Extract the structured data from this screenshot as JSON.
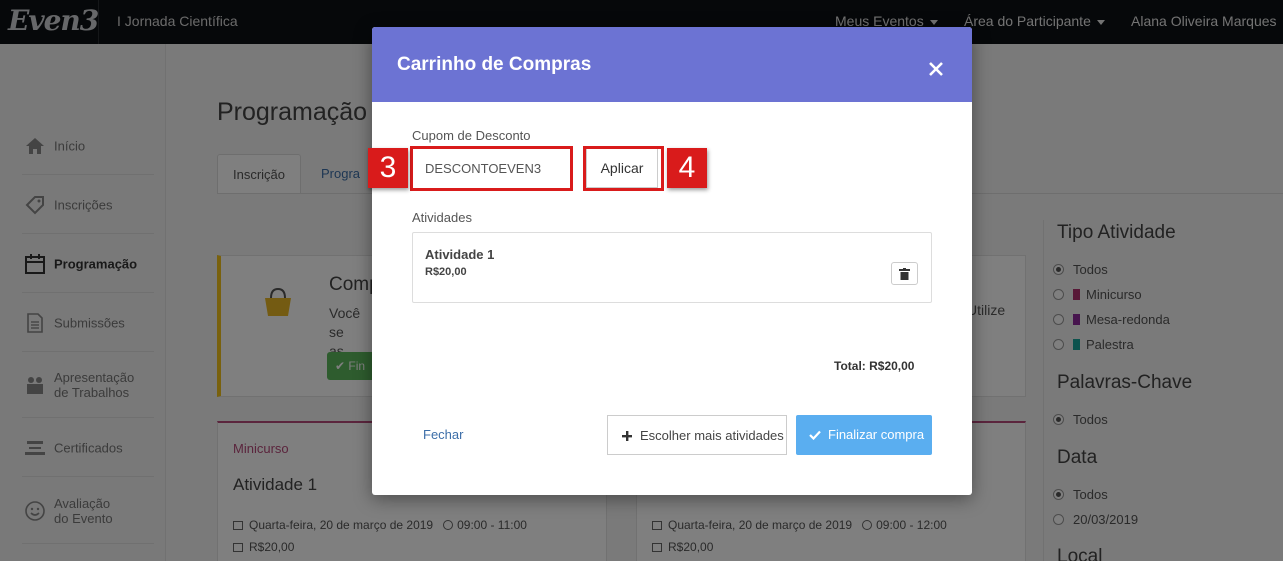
{
  "topbar": {
    "logo": "Even3",
    "event_name": "I Jornada Científica",
    "nav": [
      "Meus Eventos",
      "Área do Participante"
    ],
    "user": "Alana Oliveira Marques"
  },
  "sidebar": {
    "items": [
      {
        "label": "Início",
        "icon": "home-icon"
      },
      {
        "label": "Inscrições",
        "icon": "tag-icon"
      },
      {
        "label": "Programação",
        "icon": "calendar-icon",
        "active": true
      },
      {
        "label": "Submissões",
        "icon": "document-icon"
      },
      {
        "label": "Apresentação de Trabalhos",
        "line1": "Apresentação",
        "line2": "de Trabalhos",
        "icon": "presentation-icon"
      },
      {
        "label": "Certificados",
        "icon": "certificate-icon"
      },
      {
        "label": "Avaliação do Evento",
        "line1": "Avaliação",
        "line2": "do Evento",
        "icon": "smiley-icon"
      }
    ]
  },
  "page": {
    "title": "Programação",
    "tabs": [
      "Inscrição",
      "Progra"
    ],
    "banner": {
      "title": "Comp",
      "text_line1": "Você se",
      "text_line2": "as opçõ",
      "right_text": "Utilize",
      "button": "Fin"
    },
    "cards": [
      {
        "type": "Minicurso",
        "title": "Atividade 1",
        "date": "Quarta-feira, 20 de março de 2019",
        "time": "09:00 - 11:00",
        "price": "R$20,00"
      },
      {
        "type": "",
        "title": "",
        "date": "Quarta-feira, 20 de março de 2019",
        "time": "09:00 - 12:00",
        "price": "R$20,00"
      }
    ]
  },
  "filters": {
    "tipo": {
      "title": "Tipo Atividade",
      "options": [
        "Todos",
        "Minicurso",
        "Mesa-redonda",
        "Palestra"
      ]
    },
    "palavras": {
      "title": "Palavras-Chave",
      "options": [
        "Todos"
      ]
    },
    "data": {
      "title": "Data",
      "options": [
        "Todos",
        "20/03/2019"
      ]
    },
    "local": {
      "title": "Local"
    },
    "colors": {
      "minicurso": "#b0306e",
      "mesa": "#8e2a9c",
      "palestra": "#1aa79c"
    }
  },
  "modal": {
    "title": "Carrinho de Compras",
    "coupon_label": "Cupom de Desconto",
    "coupon_value": "DESCONTOEVEN3",
    "apply_label": "Aplicar",
    "activities_label": "Atividades",
    "activity": {
      "name": "Atividade 1",
      "price": "R$20,00"
    },
    "total": "Total: R$20,00",
    "close_label": "Fechar",
    "more_label": "Escolher mais atividades",
    "finish_label": "Finalizar compra",
    "header_color": "#6c73d3"
  },
  "callouts": {
    "step3": "3",
    "step4": "4"
  }
}
